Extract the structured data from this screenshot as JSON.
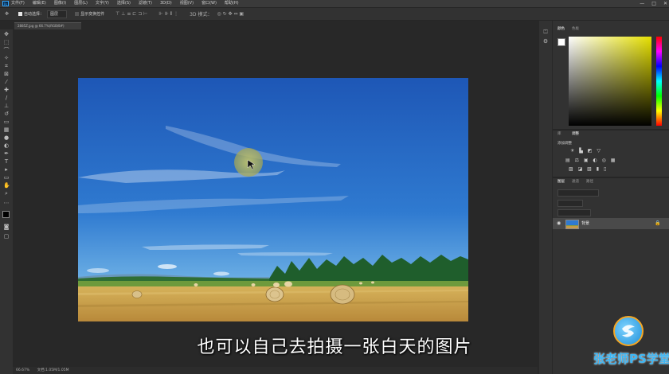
{
  "menubar": {
    "logo": "Ps",
    "items": [
      "文件(F)",
      "编辑(E)",
      "图像(I)",
      "图层(L)",
      "文字(Y)",
      "选择(S)",
      "滤镜(T)",
      "3D(D)",
      "视图(V)",
      "窗口(W)",
      "帮助(H)"
    ],
    "window_controls": [
      "—",
      "□",
      "✕"
    ]
  },
  "options": {
    "auto_select_label": "自动选择：",
    "auto_select_value": "图层",
    "transform_label": "显示变换控件",
    "mode_label": "3D 模式："
  },
  "document": {
    "tab_label": "2885Z.jpg @ 66.7%(RGB/8#)",
    "zoom": "66.67%",
    "doc_size": "文档:1.05M/1.05M"
  },
  "panels": {
    "color_tabs": [
      "颜色",
      "色板"
    ],
    "adjust_tabs": [
      "库",
      "调整"
    ],
    "adjust_header": "添加调整",
    "layer_tabs": [
      "图层",
      "通道",
      "路径"
    ],
    "layer_name": "背景"
  },
  "subtitle": "也可以自己去拍摄一张白天的图片",
  "watermark": "张老师PS学堂",
  "colors": {
    "accent": "#31a8ff",
    "sky_top": "#1f5cb8",
    "field": "#c89a48"
  }
}
